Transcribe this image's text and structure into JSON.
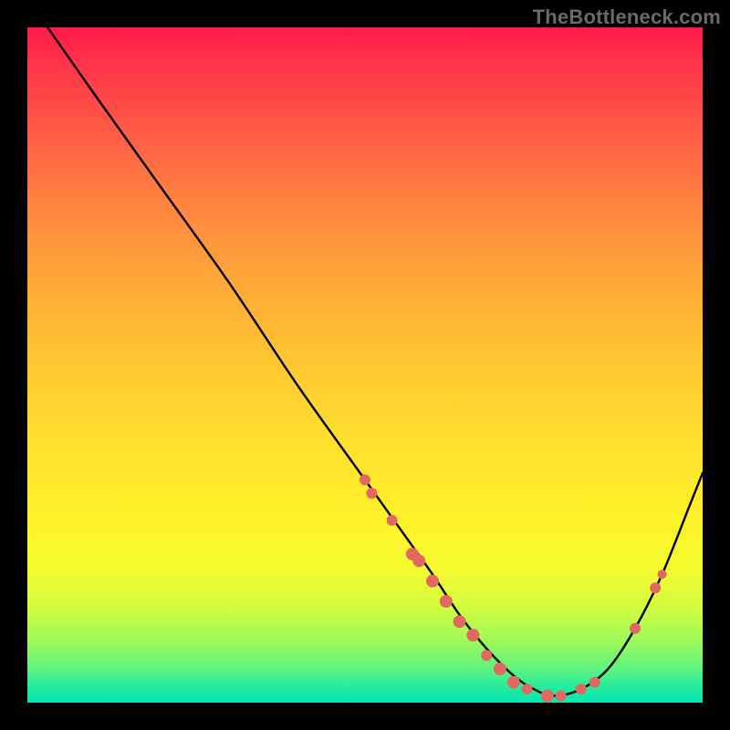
{
  "watermark": "TheBottleneck.com",
  "colors": {
    "background": "#000000",
    "gradient_top": "#ff1a4b",
    "gradient_mid": "#ffdd2e",
    "gradient_bottom": "#06e6b3",
    "curve": "#000000",
    "markers": "#e2695f"
  },
  "chart_data": {
    "type": "line",
    "title": "",
    "xlabel": "",
    "ylabel": "",
    "xlim": [
      0,
      100
    ],
    "ylim": [
      0,
      100
    ],
    "grid": false,
    "series": [
      {
        "name": "bottleneck-curve",
        "x": [
          3,
          10,
          20,
          30,
          40,
          50,
          55,
          60,
          64,
          68,
          72,
          75,
          78,
          82,
          86,
          90,
          94,
          98,
          100
        ],
        "y": [
          100,
          90,
          76,
          62,
          47,
          33,
          26,
          19,
          13,
          8,
          4,
          2,
          1,
          2,
          5,
          11,
          19,
          29,
          34
        ]
      }
    ],
    "markers": {
      "name": "highlighted-points",
      "points": [
        {
          "x": 50,
          "y": 33,
          "r": 6
        },
        {
          "x": 51,
          "y": 31,
          "r": 6
        },
        {
          "x": 54,
          "y": 27,
          "r": 6
        },
        {
          "x": 57,
          "y": 22,
          "r": 7
        },
        {
          "x": 58,
          "y": 21,
          "r": 7
        },
        {
          "x": 60,
          "y": 18,
          "r": 7
        },
        {
          "x": 62,
          "y": 15,
          "r": 7
        },
        {
          "x": 64,
          "y": 12,
          "r": 7
        },
        {
          "x": 66,
          "y": 10,
          "r": 7
        },
        {
          "x": 68,
          "y": 7,
          "r": 6
        },
        {
          "x": 70,
          "y": 5,
          "r": 7
        },
        {
          "x": 72,
          "y": 3,
          "r": 7
        },
        {
          "x": 74,
          "y": 2,
          "r": 6
        },
        {
          "x": 77,
          "y": 1,
          "r": 7
        },
        {
          "x": 79,
          "y": 1,
          "r": 6
        },
        {
          "x": 82,
          "y": 2,
          "r": 6
        },
        {
          "x": 84,
          "y": 3,
          "r": 6
        },
        {
          "x": 90,
          "y": 11,
          "r": 6
        },
        {
          "x": 93,
          "y": 17,
          "r": 6
        },
        {
          "x": 94,
          "y": 19,
          "r": 5
        }
      ]
    }
  }
}
